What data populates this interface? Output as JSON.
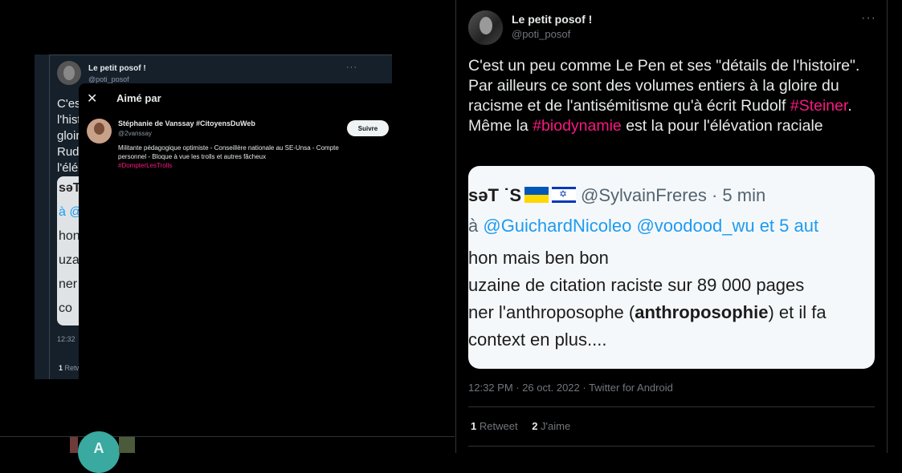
{
  "left_panel": {
    "tweet": {
      "author_name": "Le petit posof !",
      "author_handle": "@poti_posof",
      "more": "···",
      "text_fragments": [
        "C'est",
        "l'hist",
        "gloir",
        "Rud",
        "l'élé"
      ],
      "card_fragments": [
        "səT",
        "à @",
        "hon",
        "uza",
        "ner",
        "co"
      ],
      "time": "12:32",
      "retweet_count": "1",
      "retweet_label": "Retw"
    },
    "modal": {
      "close": "✕",
      "title": "Aimé par",
      "user": {
        "name": "Stéphanie de Vanssay #CitoyensDuWeb",
        "handle": "@2vanssay",
        "bio": "Militante pédagogique optimiste - Conseillère nationale au SE-Unsa - Compte personnel - Bloque à vue les trolls et autres fâcheux",
        "bio_tag": "#DompterLesTrolls",
        "follow_label": "Suivre"
      }
    }
  },
  "bottom": {
    "avatar_letter": "A"
  },
  "tweet": {
    "author_name": "Le petit posof !",
    "author_handle": "@poti_posof",
    "more": "···",
    "text": {
      "part1": "C'est un peu comme Le Pen et ses \"détails de l'histoire\". Par ailleurs ce sont des volumes entiers à la gloire du racisme et de l'antisémitisme qu'à écrit Rudolf ",
      "hashtag1": "#Steiner",
      "part2": ". Même la ",
      "hashtag2": "#biodynamie",
      "part3": " est la pour l'élévation raciale"
    },
    "media": {
      "line1_prefix": "səT ˙S",
      "line1_handle": "@SylvainFreres · 5 min",
      "line2_prefix": "à ",
      "line2_mention1": "@GuichardNicoleo",
      "line2_mention2": "@voodood_wu",
      "line2_suffix": " et 5 aut",
      "line3": "hon mais ben bon",
      "line4": "uzaine de citation raciste sur 89 000 pages",
      "line5_a": "ner l'anthroposophe (",
      "line5_b": "anthroposophie",
      "line5_c": ") et il fa",
      "line6": " context en plus...."
    },
    "meta": "12:32 PM · 26 oct. 2022 · Twitter for Android",
    "stats": {
      "retweets": "1",
      "retweets_label": "Retweet",
      "likes": "2",
      "likes_label": "J'aime"
    }
  }
}
